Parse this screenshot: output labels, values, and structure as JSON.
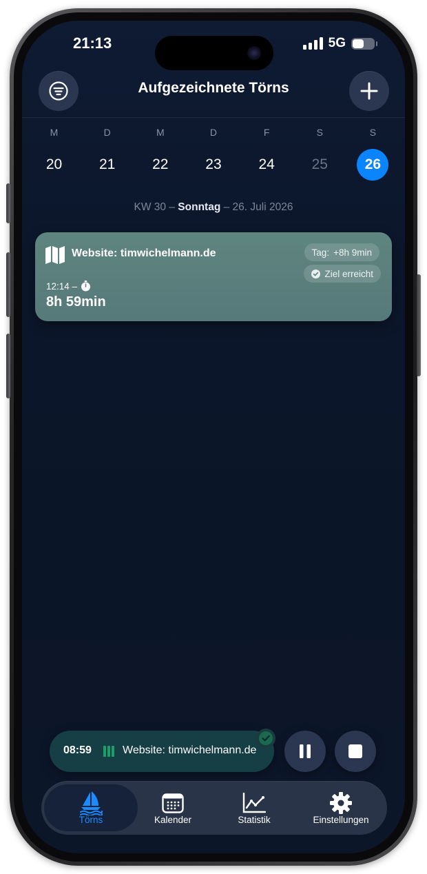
{
  "status_bar": {
    "time": "21:13",
    "network": "5G"
  },
  "header": {
    "title": "Aufgezeichnete Törns"
  },
  "week": {
    "days": [
      {
        "letter": "M",
        "number": "20"
      },
      {
        "letter": "D",
        "number": "21"
      },
      {
        "letter": "M",
        "number": "22"
      },
      {
        "letter": "D",
        "number": "23"
      },
      {
        "letter": "F",
        "number": "24"
      },
      {
        "letter": "S",
        "number": "25"
      },
      {
        "letter": "S",
        "number": "26"
      }
    ],
    "selected_index": 6,
    "week_label": "KW 30",
    "sep1": "–",
    "weekday": "Sonntag",
    "sep2": "–",
    "date": "26. Juli 2026"
  },
  "entry": {
    "title": "Website: timwichelmann.de",
    "day_label": "Tag:",
    "day_value": "+8h 9min",
    "goal_label": "Ziel erreicht",
    "start": "12:14 –",
    "duration": "8h 59min"
  },
  "live_session": {
    "elapsed": "08:59",
    "name": "Website: timwichelmann.de"
  },
  "tabbar": {
    "tabs": [
      {
        "label": "Törns"
      },
      {
        "label": "Kalender"
      },
      {
        "label": "Statistik"
      },
      {
        "label": "Einstellungen"
      }
    ]
  },
  "colors": {
    "accent": "#0a84ff",
    "card": "#5f857f",
    "live_pill": "#163e45",
    "background": "#0c172c"
  },
  "icons": [
    "filter-icon",
    "plus-icon",
    "map-icon",
    "stopwatch-icon",
    "checkmark-circle-icon",
    "pause-icon",
    "stop-icon",
    "sailboat-icon",
    "calendar-icon",
    "chart-icon",
    "gear-icon"
  ]
}
